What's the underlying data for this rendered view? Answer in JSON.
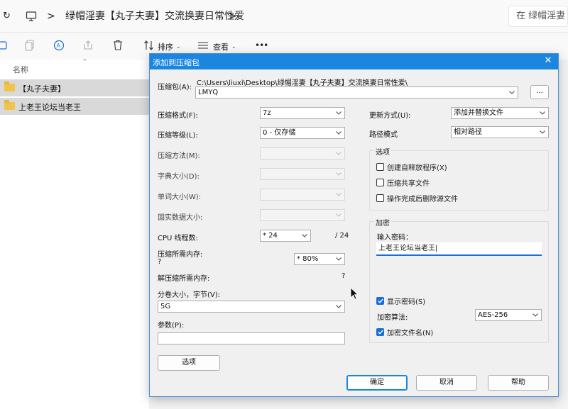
{
  "explorer": {
    "breadcrumb_sep": ">",
    "folder_path": "绿帽淫妻【丸子夫妻】交流换妻日常性爱",
    "search_placeholder": "在 绿帽淫妻",
    "toolbar": {
      "sort_label": "排序",
      "view_label": "查看",
      "more_label": "•••"
    },
    "column_name": "名称",
    "files": [
      "【丸子夫妻】",
      "上老王论坛当老王"
    ]
  },
  "dialog": {
    "title": "添加到压缩包",
    "archive_label": "压缩包(A):",
    "archive_path": "C:\\Users\\liuxi\\Desktop\\绿帽淫妻【丸子夫妻】交流换妻日常性爱\\",
    "archive_name": "LMYQ",
    "browse_label": "...",
    "left": {
      "format_label": "压缩格式(F):",
      "format_value": "7z",
      "level_label": "压缩等级(L):",
      "level_value": "0 - 仅存储",
      "method_label": "压缩方法(M):",
      "dict_label": "字典大小(D):",
      "word_label": "单词大小(W):",
      "solid_label": "固实数据大小:",
      "threads_label": "CPU 线程数:",
      "threads_value": "* 24",
      "threads_max": "/ 24",
      "mem_label": "压缩所需内存:",
      "mem_q": "?",
      "mem_value": "* 80%",
      "decomp_label": "解压缩所需内存:",
      "decomp_q": "?",
      "split_label": "分卷大小，字节(V):",
      "split_value": "5G",
      "params_label": "参数(P):",
      "options_button": "选项"
    },
    "right": {
      "update_label": "更新方式(U):",
      "update_value": "添加并替换文件",
      "path_label": "路径模式",
      "path_value": "相对路径",
      "options_group": "选项",
      "sfx_label": "创建自释放程序(X)",
      "shared_label": "压缩共享文件",
      "delete_label": "操作完成后删除源文件",
      "encrypt_group": "加密",
      "password_label": "输入密码：",
      "password_value": "上老王论坛当老王",
      "show_password_label": "显示密码(S)",
      "algo_label": "加密算法:",
      "algo_value": "AES-256",
      "encrypt_names_label": "加密文件名(N)"
    },
    "buttons": {
      "ok": "确定",
      "cancel": "取消",
      "help": "帮助"
    }
  }
}
